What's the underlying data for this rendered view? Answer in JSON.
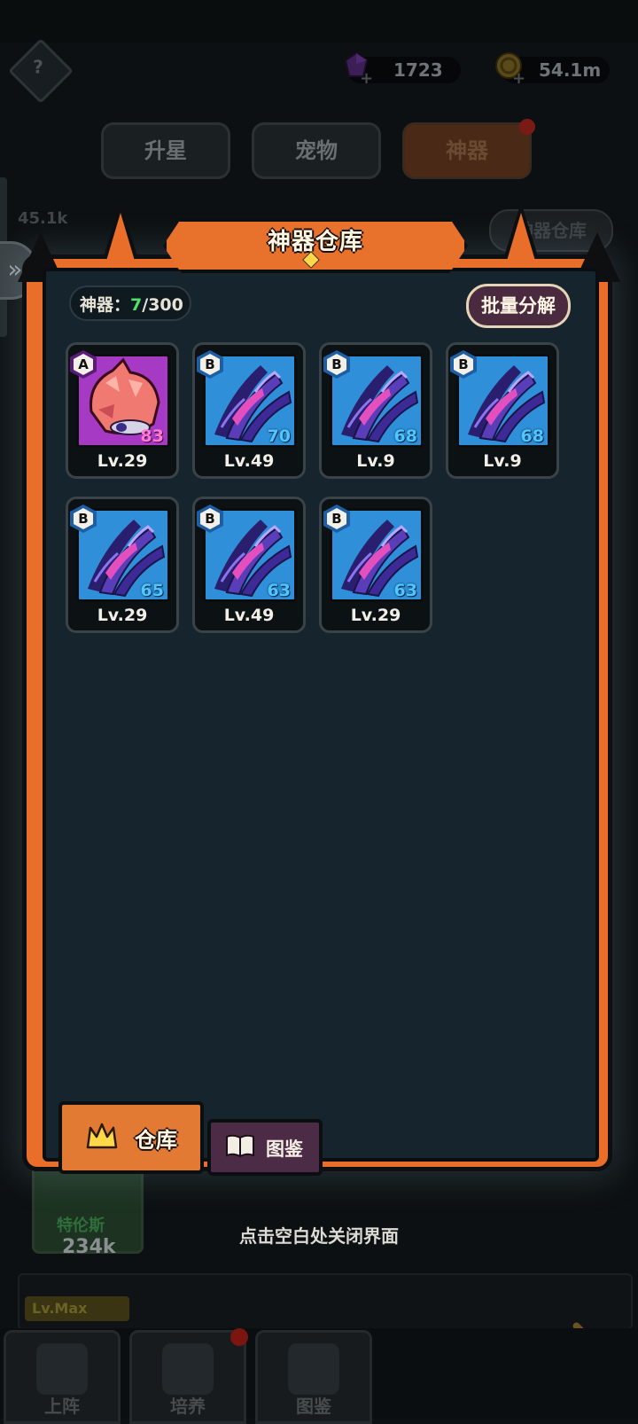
{
  "header": {
    "gems": "1723",
    "gold": "54.1m"
  },
  "top_tabs": [
    {
      "label": "升星"
    },
    {
      "label": "宠物"
    },
    {
      "label": "神器"
    }
  ],
  "background": {
    "store_button": "神器仓库",
    "hero_name": "特伦斯",
    "hero_power": "234k",
    "hero_level": "Lv.Max",
    "power_partial": "45.1k"
  },
  "modal": {
    "title": "神器仓库",
    "count_label": "神器：",
    "count_current": "7",
    "count_max": "/300",
    "batch_button": "批量分解",
    "items": [
      {
        "rarity": "A",
        "power": "83",
        "level": "Lv.29"
      },
      {
        "rarity": "B",
        "power": "70",
        "level": "Lv.49"
      },
      {
        "rarity": "B",
        "power": "68",
        "level": "Lv.9"
      },
      {
        "rarity": "B",
        "power": "68",
        "level": "Lv.9"
      },
      {
        "rarity": "B",
        "power": "65",
        "level": "Lv.29"
      },
      {
        "rarity": "B",
        "power": "63",
        "level": "Lv.49"
      },
      {
        "rarity": "B",
        "power": "63",
        "level": "Lv.29"
      }
    ],
    "tabs": {
      "store": "仓库",
      "codex": "图鉴"
    },
    "close_hint": "点击空白处关闭界面"
  },
  "bottom_nav": [
    {
      "label": "上阵"
    },
    {
      "label": "培养"
    },
    {
      "label": "图鉴"
    }
  ],
  "colors": {
    "panel_orange": "#e86e2a",
    "panel_bg": "#15242d",
    "rarity_b_bg": "#2f8fd8",
    "rarity_a_bg": "#a63ac4",
    "count_green": "#4ee06a"
  },
  "icons": [
    "gem-icon",
    "gold-coin-icon",
    "crown-icon",
    "book-icon",
    "double-chevron-icon"
  ]
}
